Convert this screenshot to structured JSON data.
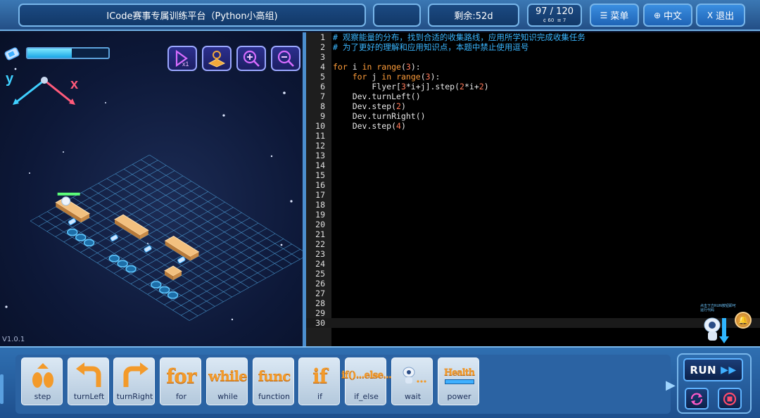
{
  "header": {
    "title": "ICode赛事专属训练平台（Python小高组)",
    "remaining": "剩余:52d",
    "score": "97 / 120",
    "score_sub_a": "60",
    "score_sub_b": "7",
    "menu_label": "菜单",
    "lang_label": "中文",
    "exit_label": "退出",
    "menu_icon": "menu-lines-icon",
    "lang_icon": "globe-icon",
    "exit_icon": "close-x-icon"
  },
  "game": {
    "energy_level": 0.55,
    "axis_y": "y",
    "axis_x": "x",
    "version": "V1.0.1",
    "tools": [
      "replay-speed-icon",
      "map-view-icon",
      "zoom-in-icon",
      "zoom-out-icon"
    ]
  },
  "editor": {
    "lines": [
      {
        "n": "1",
        "code": "# 观察能量的分布，找到合适的收集路线，应用所学知识完成收集任务"
      },
      {
        "n": "2",
        "code": "# 为了更好的理解和应用知识点，本题中禁止使用逗号"
      },
      {
        "n": "3",
        "code": ""
      },
      {
        "n": "4",
        "code": "for i in range(3):"
      },
      {
        "n": "5",
        "code": "    for j in range(3):"
      },
      {
        "n": "6",
        "code": "        Flyer[3*i+j].step(2*i+2)"
      },
      {
        "n": "7",
        "code": "    Dev.turnLeft()"
      },
      {
        "n": "8",
        "code": "    Dev.step(2)"
      },
      {
        "n": "9",
        "code": "    Dev.turnRight()"
      },
      {
        "n": "10",
        "code": "    Dev.step(4)"
      },
      {
        "n": "11",
        "code": ""
      },
      {
        "n": "12",
        "code": ""
      },
      {
        "n": "13",
        "code": ""
      },
      {
        "n": "14",
        "code": ""
      },
      {
        "n": "15",
        "code": ""
      },
      {
        "n": "16",
        "code": ""
      },
      {
        "n": "17",
        "code": ""
      },
      {
        "n": "18",
        "code": ""
      },
      {
        "n": "19",
        "code": ""
      },
      {
        "n": "20",
        "code": ""
      },
      {
        "n": "21",
        "code": ""
      },
      {
        "n": "22",
        "code": ""
      },
      {
        "n": "23",
        "code": ""
      },
      {
        "n": "24",
        "code": ""
      },
      {
        "n": "25",
        "code": ""
      },
      {
        "n": "26",
        "code": ""
      },
      {
        "n": "27",
        "code": ""
      },
      {
        "n": "28",
        "code": ""
      },
      {
        "n": "29",
        "code": ""
      },
      {
        "n": "30",
        "code": ""
      }
    ],
    "robot_tip": "点击下方RUN按钮即可运行代码"
  },
  "blocks": [
    {
      "id": "step",
      "label": "step",
      "word": ""
    },
    {
      "id": "turnLeft",
      "label": "turnLeft",
      "word": ""
    },
    {
      "id": "turnRight",
      "label": "turnRight",
      "word": ""
    },
    {
      "id": "for",
      "label": "for",
      "word": "for"
    },
    {
      "id": "while",
      "label": "while",
      "word": "while"
    },
    {
      "id": "function",
      "label": "function",
      "word": "func"
    },
    {
      "id": "if",
      "label": "if",
      "word": "if"
    },
    {
      "id": "if_else",
      "label": "if_else",
      "word": "if()...else..."
    },
    {
      "id": "wait",
      "label": "wait",
      "word": ""
    },
    {
      "id": "power",
      "label": "power",
      "word": "Health"
    }
  ],
  "controls": {
    "run_label": "RUN",
    "reset_icon": "refresh-icon",
    "stop_icon": "stop-icon"
  },
  "colors": {
    "accent": "#3a8ee0",
    "code_keyword": "#ff9d3a",
    "code_comment": "#3ab6ff",
    "code_number": "#ff7a5a",
    "block_text": "#f39a2a"
  }
}
